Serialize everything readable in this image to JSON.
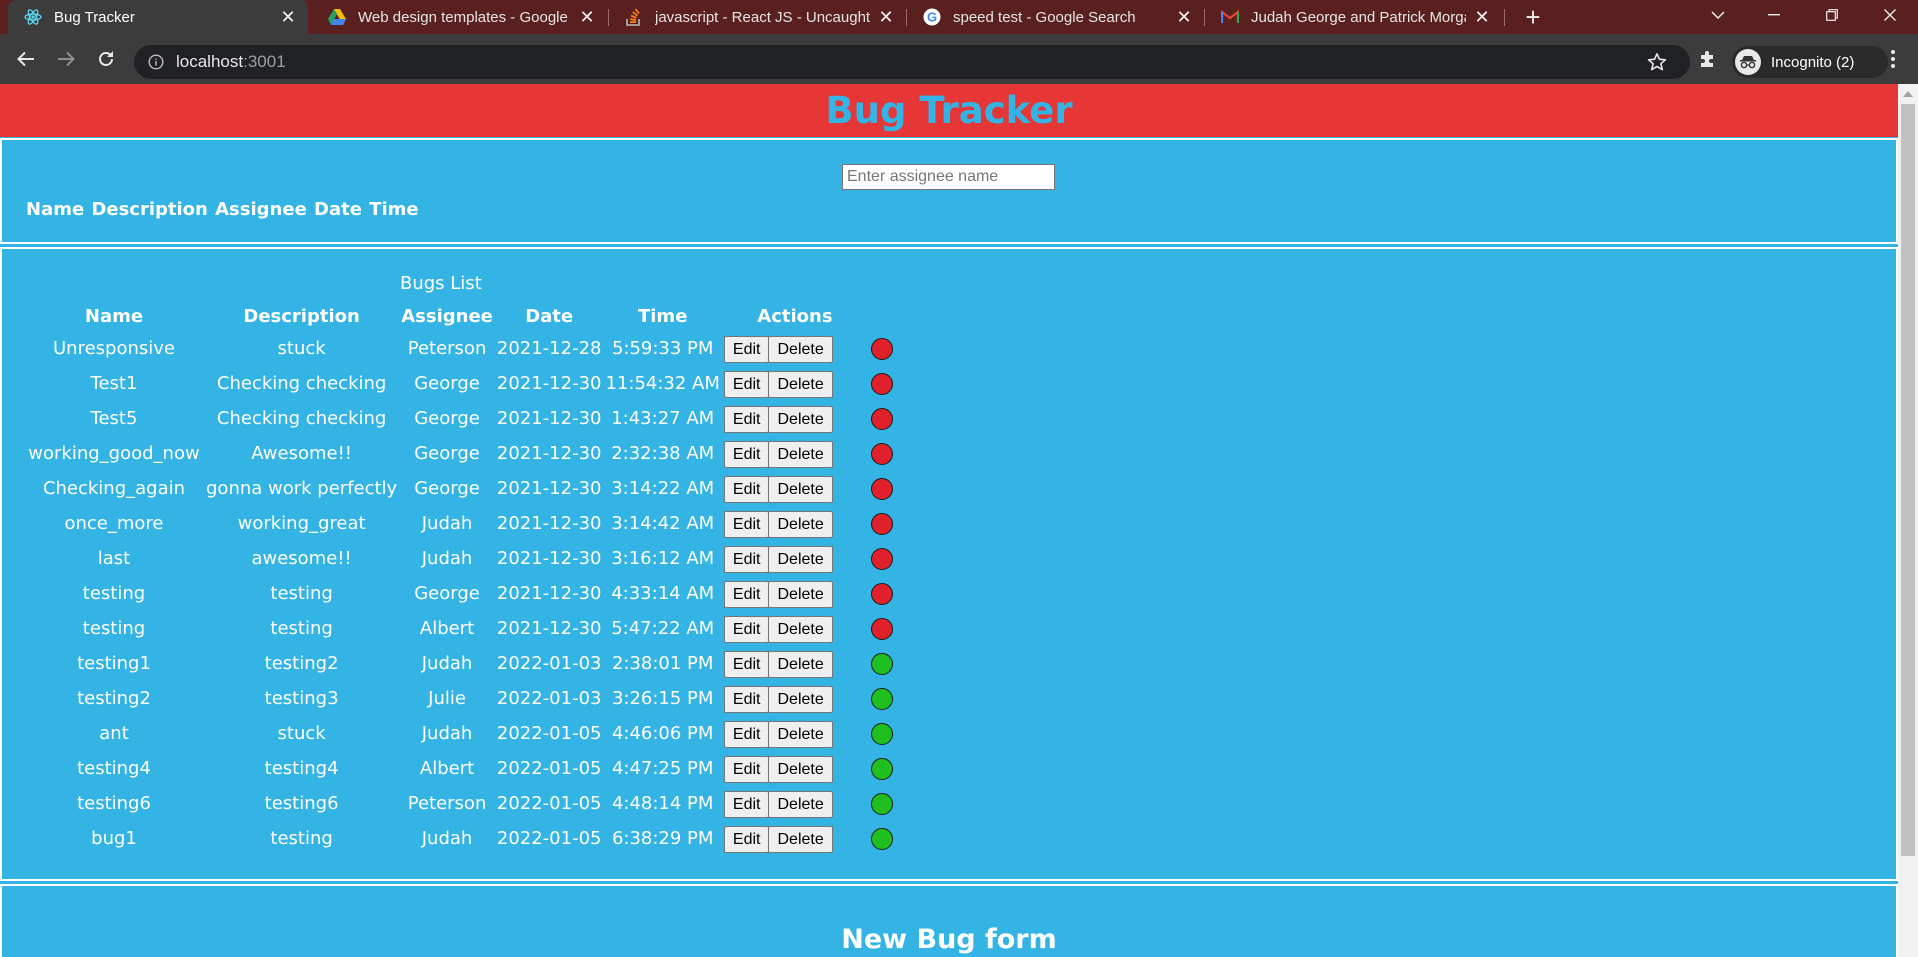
{
  "browser": {
    "tabs": [
      {
        "title": "Bug Tracker",
        "icon": "react-icon",
        "active": true
      },
      {
        "title": "Web design templates - Google Drive",
        "icon": "google-drive-icon",
        "active": false
      },
      {
        "title": "javascript - React JS - Uncaught TypeError",
        "icon": "stackoverflow-icon",
        "active": false
      },
      {
        "title": "speed test - Google Search",
        "icon": "google-icon",
        "active": false
      },
      {
        "title": "Judah George and Patrick Morgan",
        "icon": "gmail-icon",
        "active": false
      }
    ],
    "new_tab_label": "+",
    "url_host": "localhost",
    "url_port": ":3001",
    "profile_label": "Incognito (2)"
  },
  "app": {
    "title": "Bug Tracker",
    "search_placeholder": "Enter assignee name",
    "header_fields": "Name Description Assignee Date Time",
    "list_caption": "Bugs List",
    "columns": [
      "Name",
      "Description",
      "Assignee",
      "Date",
      "Time",
      "Actions"
    ],
    "edit_label": "Edit",
    "delete_label": "Delete",
    "status_colors": {
      "open": "#e0202b",
      "resolved": "#1fbf1f"
    },
    "rows": [
      {
        "name": "Unresponsive",
        "description": "stuck",
        "assignee": "Peterson",
        "date": "2021-12-28",
        "time": "5:59:33 PM",
        "status": "open"
      },
      {
        "name": "Test1",
        "description": "Checking checking",
        "assignee": "George",
        "date": "2021-12-30",
        "time": "11:54:32 AM",
        "status": "open"
      },
      {
        "name": "Test5",
        "description": "Checking checking",
        "assignee": "George",
        "date": "2021-12-30",
        "time": "1:43:27 AM",
        "status": "open"
      },
      {
        "name": "working_good_now",
        "description": "Awesome!!",
        "assignee": "George",
        "date": "2021-12-30",
        "time": "2:32:38 AM",
        "status": "open"
      },
      {
        "name": "Checking_again",
        "description": "gonna work perfectly",
        "assignee": "George",
        "date": "2021-12-30",
        "time": "3:14:22 AM",
        "status": "open"
      },
      {
        "name": "once_more",
        "description": "working_great",
        "assignee": "Judah",
        "date": "2021-12-30",
        "time": "3:14:42 AM",
        "status": "open"
      },
      {
        "name": "last",
        "description": "awesome!!",
        "assignee": "Judah",
        "date": "2021-12-30",
        "time": "3:16:12 AM",
        "status": "open"
      },
      {
        "name": "testing",
        "description": "testing",
        "assignee": "George",
        "date": "2021-12-30",
        "time": "4:33:14 AM",
        "status": "open"
      },
      {
        "name": "testing",
        "description": "testing",
        "assignee": "Albert",
        "date": "2021-12-30",
        "time": "5:47:22 AM",
        "status": "open"
      },
      {
        "name": "testing1",
        "description": "testing2",
        "assignee": "Judah",
        "date": "2022-01-03",
        "time": "2:38:01 PM",
        "status": "resolved"
      },
      {
        "name": "testing2",
        "description": "testing3",
        "assignee": "Julie",
        "date": "2022-01-03",
        "time": "3:26:15 PM",
        "status": "resolved"
      },
      {
        "name": "ant",
        "description": "stuck",
        "assignee": "Judah",
        "date": "2022-01-05",
        "time": "4:46:06 PM",
        "status": "resolved"
      },
      {
        "name": "testing4",
        "description": "testing4",
        "assignee": "Albert",
        "date": "2022-01-05",
        "time": "4:47:25 PM",
        "status": "resolved"
      },
      {
        "name": "testing6",
        "description": "testing6",
        "assignee": "Peterson",
        "date": "2022-01-05",
        "time": "4:48:14 PM",
        "status": "resolved"
      },
      {
        "name": "bug1",
        "description": "testing",
        "assignee": "Judah",
        "date": "2022-01-05",
        "time": "6:38:29 PM",
        "status": "resolved"
      }
    ],
    "form_title": "New Bug form"
  }
}
